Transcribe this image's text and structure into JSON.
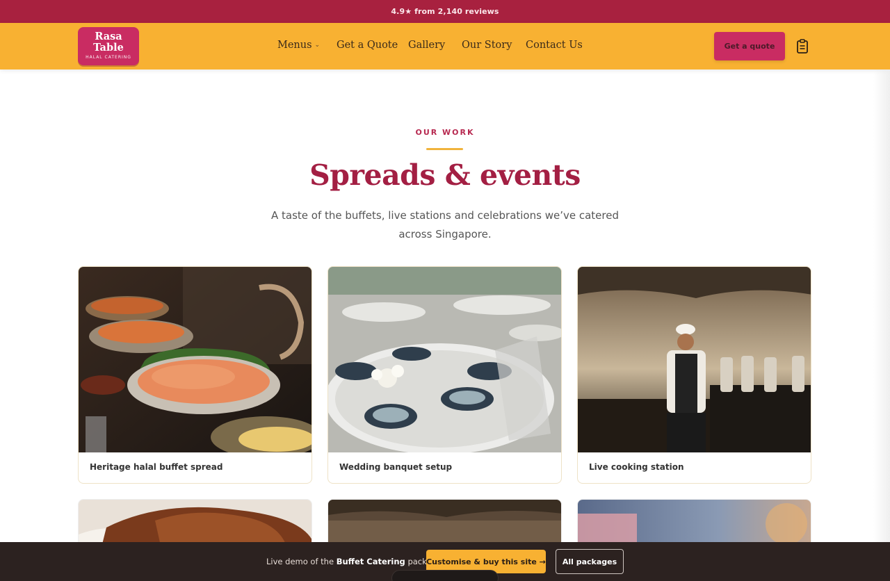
{
  "announcement": {
    "text": "4.9★ from 2,140 reviews"
  },
  "header": {
    "logo": {
      "name_line1": "Rasa",
      "name_line2": "Table",
      "tagline": "HALAL CATERING"
    },
    "nav": [
      {
        "label": "Menus",
        "has_dropdown": true
      },
      {
        "label": "Get a Quote"
      },
      {
        "label": "Gallery"
      },
      {
        "label": "Our Story"
      },
      {
        "label": "Contact Us"
      }
    ],
    "cta_label": "Get a quote",
    "cart_icon": "clipboard-icon"
  },
  "section": {
    "eyebrow": "OUR WORK",
    "title": "Spreads & events",
    "subtitle": "A taste of the buffets, live stations and celebrations we’ve catered across Singapore."
  },
  "gallery": {
    "cards": [
      {
        "label": "Heritage halal buffet spread",
        "image": "buffet-photo"
      },
      {
        "label": "Wedding banquet setup",
        "image": "banquet-photo"
      },
      {
        "label": "Live cooking station",
        "image": "chef-station-photo"
      }
    ],
    "row2_images": [
      "fried-chicken-photo",
      "tent-photo",
      "outdoor-blur-photo"
    ]
  },
  "demo_bar": {
    "text_prefix": "Live demo of the ",
    "package_name": "Buffet Catering",
    "text_suffix": " package.",
    "buy_label": "Customise & buy this site →",
    "packages_label": "All packages"
  },
  "colors": {
    "brand_crimson": "#a8213f",
    "brand_pink": "#c92c62",
    "brand_gold": "#f8b132",
    "dark_bar": "#2c2220"
  }
}
